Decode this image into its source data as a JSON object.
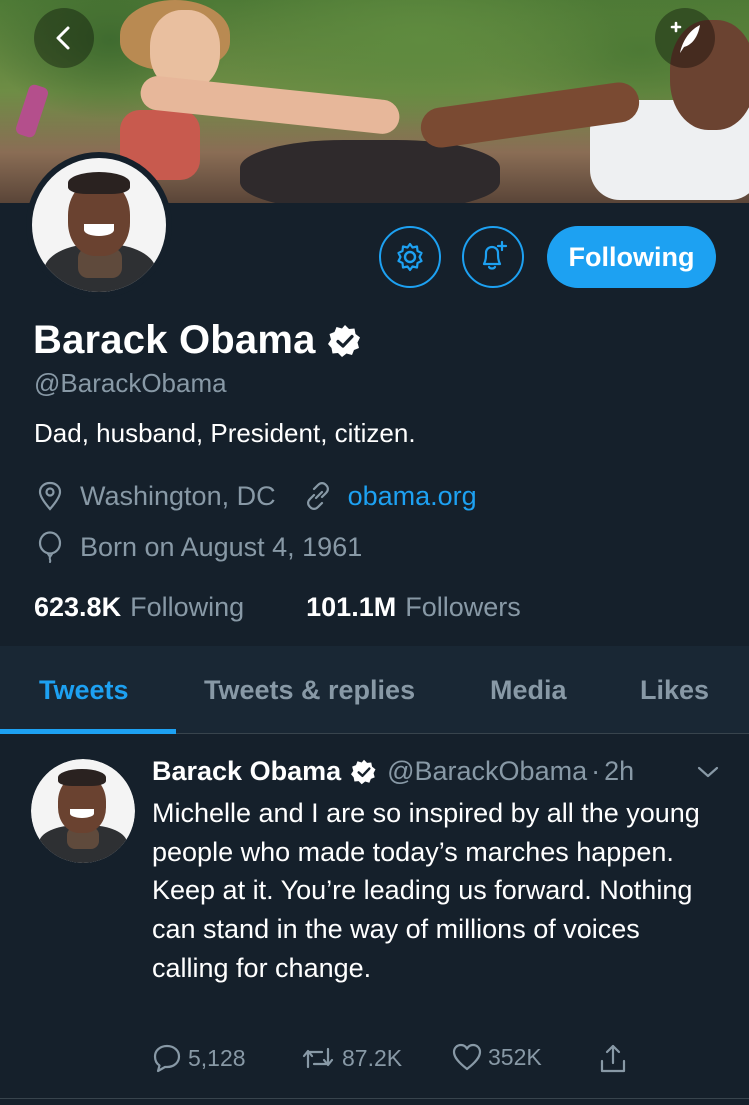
{
  "colors": {
    "background": "#15202b",
    "accent": "#1da1f2",
    "secondary_text": "#8899a6",
    "tab_bar": "#192734"
  },
  "header": {
    "back_icon": "chevron-left-icon",
    "compose_icon": "compose-feather-icon"
  },
  "profile": {
    "name": "Barack Obama",
    "verified": true,
    "handle": "@BarackObama",
    "bio": "Dad, husband, President, citizen.",
    "location": "Washington, DC",
    "website": "obama.org",
    "birthday": "Born on August 4, 1961",
    "following_count": "623.8K",
    "following_label": "Following",
    "followers_count": "101.1M",
    "followers_label": "Followers"
  },
  "actions": {
    "settings_icon": "gear-icon",
    "notify_icon": "bell-plus-icon",
    "follow_label": "Following"
  },
  "tabs": [
    {
      "label": "Tweets",
      "active": true
    },
    {
      "label": "Tweets & replies",
      "active": false
    },
    {
      "label": "Media",
      "active": false
    },
    {
      "label": "Likes",
      "active": false
    }
  ],
  "tweet": {
    "author": "Barack Obama",
    "handle": "@BarackObama",
    "separator": "·",
    "time": "2h",
    "text": "Michelle and I are so inspired by all the young people who made today’s marches happen. Keep at it. You’re leading us forward. Nothing can stand in the way of millions of voices calling for change.",
    "replies": "5,128",
    "retweets": "87.2K",
    "likes": "352K"
  }
}
